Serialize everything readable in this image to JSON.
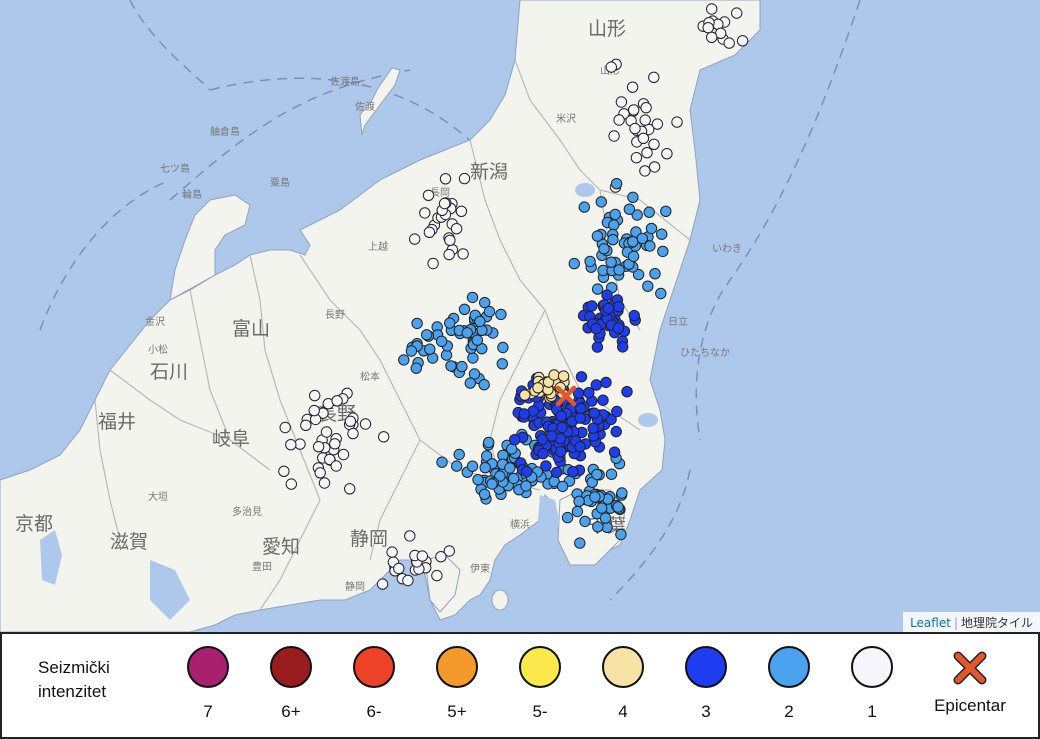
{
  "map": {
    "attribution": {
      "leaflet": "Leaflet",
      "separator": "|",
      "tiles": "地理院タイル"
    },
    "colors": {
      "sea": "#aec8ec",
      "land": "#f4f4ee",
      "mountain": "#e8eadb",
      "boundary": "#b8b8b8"
    },
    "place_labels": [
      {
        "text": "新潟",
        "size": "big"
      },
      {
        "text": "山形",
        "size": "big"
      },
      {
        "text": "富山",
        "size": "big"
      },
      {
        "text": "石川",
        "size": "big"
      },
      {
        "text": "福井",
        "size": "big"
      },
      {
        "text": "岐阜",
        "size": "big"
      },
      {
        "text": "長野",
        "size": "big"
      },
      {
        "text": "愛知",
        "size": "big"
      },
      {
        "text": "静岡",
        "size": "big"
      },
      {
        "text": "京都",
        "size": "big"
      },
      {
        "text": "滋賀",
        "size": "big"
      },
      {
        "text": "千葉",
        "size": "big"
      },
      {
        "text": "佐渡島",
        "size": "small"
      },
      {
        "text": "佐渡",
        "size": "small"
      },
      {
        "text": "輪島",
        "size": "small"
      },
      {
        "text": "金沢",
        "size": "small"
      },
      {
        "text": "小松",
        "size": "small"
      },
      {
        "text": "松本",
        "size": "small"
      },
      {
        "text": "長野",
        "size": "small"
      },
      {
        "text": "上越",
        "size": "small"
      },
      {
        "text": "長岡",
        "size": "small"
      },
      {
        "text": "米沢",
        "size": "small"
      },
      {
        "text": "山形",
        "size": "small"
      },
      {
        "text": "日立",
        "size": "small"
      },
      {
        "text": "ひたちなか",
        "size": "small"
      },
      {
        "text": "いわき",
        "size": "small"
      },
      {
        "text": "大垣",
        "size": "small"
      },
      {
        "text": "多治見",
        "size": "small"
      },
      {
        "text": "豊田",
        "size": "small"
      },
      {
        "text": "静岡",
        "size": "small"
      },
      {
        "text": "伊東",
        "size": "small"
      },
      {
        "text": "横浜",
        "size": "small"
      },
      {
        "text": "舳倉島",
        "size": "small"
      },
      {
        "text": "七ツ島",
        "size": "small"
      },
      {
        "text": "粟島",
        "size": "small"
      }
    ],
    "epicenter_icon": "epicenter-x-icon"
  },
  "legend": {
    "title": "Seizmički intenzitet",
    "items": [
      {
        "label": "7",
        "color": "#a8206e"
      },
      {
        "label": "6+",
        "color": "#9b1c1f"
      },
      {
        "label": "6-",
        "color": "#ec4228"
      },
      {
        "label": "5+",
        "color": "#f39a2b"
      },
      {
        "label": "5-",
        "color": "#fbe94c"
      },
      {
        "label": "4",
        "color": "#f8e3a6"
      },
      {
        "label": "3",
        "color": "#1f3df0"
      },
      {
        "label": "2",
        "color": "#4aa2ee"
      },
      {
        "label": "1",
        "color": "#f5f5fb"
      }
    ],
    "epicenter": {
      "label": "Epicentar",
      "color": "#e4562c",
      "icon": "epicenter-x-icon"
    }
  }
}
